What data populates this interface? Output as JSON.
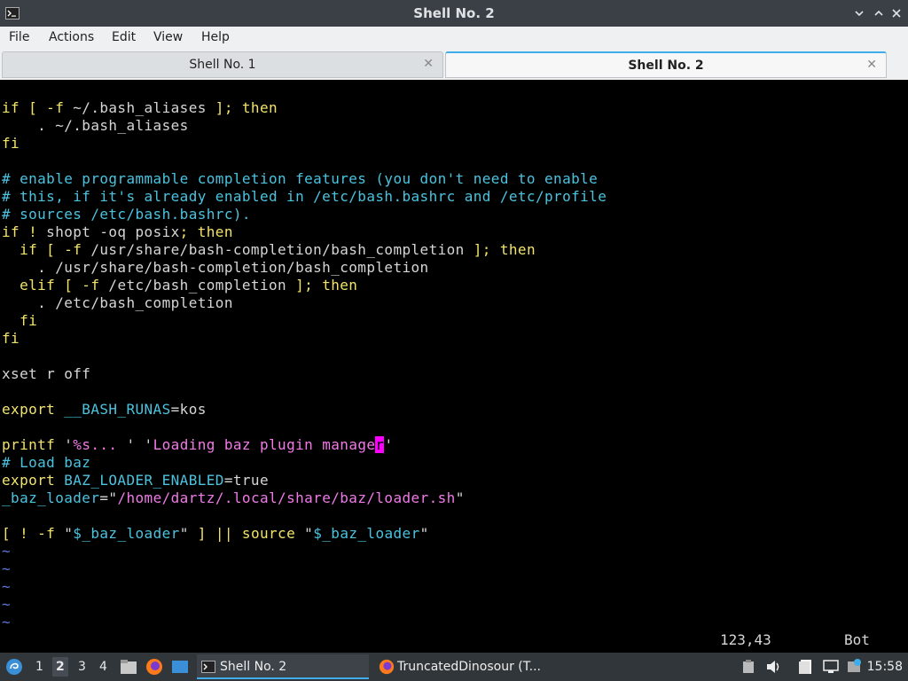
{
  "window": {
    "title": "Shell No. 2"
  },
  "menu": [
    "File",
    "Actions",
    "Edit",
    "View",
    "Help"
  ],
  "tabs": [
    {
      "label": "Shell No. 1",
      "active": false
    },
    {
      "label": "Shell No. 2",
      "active": true
    }
  ],
  "terminal": {
    "lines": [
      [],
      [
        {
          "t": "if [ -f ",
          "c": "kw"
        },
        {
          "t": "~/.bash_aliases",
          "c": "wh"
        },
        {
          "t": " ]; then",
          "c": "kw"
        }
      ],
      [
        {
          "t": "    . ~/.bash_aliases",
          "c": "wh"
        }
      ],
      [
        {
          "t": "fi",
          "c": "kw"
        }
      ],
      [],
      [
        {
          "t": "# enable programmable completion features (you don't need to enable",
          "c": "cy"
        }
      ],
      [
        {
          "t": "# this, if it's already enabled in /etc/bash.bashrc and /etc/profile",
          "c": "cy"
        }
      ],
      [
        {
          "t": "# sources /etc/bash.bashrc).",
          "c": "cy"
        }
      ],
      [
        {
          "t": "if ! ",
          "c": "kw"
        },
        {
          "t": "shopt -oq posix",
          "c": "wh"
        },
        {
          "t": "; then",
          "c": "kw"
        }
      ],
      [
        {
          "t": "  if [ -f ",
          "c": "kw"
        },
        {
          "t": "/usr/share/bash-completion/bash_completion",
          "c": "wh"
        },
        {
          "t": " ]; then",
          "c": "kw"
        }
      ],
      [
        {
          "t": "    . /usr/share/bash-completion/bash_completion",
          "c": "wh"
        }
      ],
      [
        {
          "t": "  elif [ -f ",
          "c": "kw"
        },
        {
          "t": "/etc/bash_completion",
          "c": "wh"
        },
        {
          "t": " ]; then",
          "c": "kw"
        }
      ],
      [
        {
          "t": "    . /etc/bash_completion",
          "c": "wh"
        }
      ],
      [
        {
          "t": "  fi",
          "c": "kw"
        }
      ],
      [
        {
          "t": "fi",
          "c": "kw"
        }
      ],
      [],
      [
        {
          "t": "xset r off",
          "c": "wh"
        }
      ],
      [],
      [
        {
          "t": "export ",
          "c": "kw"
        },
        {
          "t": "__BASH_RUNAS",
          "c": "cy"
        },
        {
          "t": "=kos",
          "c": "wh"
        }
      ],
      [],
      [
        {
          "t": "printf ",
          "c": "kw"
        },
        {
          "t": "'",
          "c": "wh"
        },
        {
          "t": "%s... ",
          "c": "pk"
        },
        {
          "t": "' '",
          "c": "wh"
        },
        {
          "t": "Loading baz plugin manage",
          "c": "pk"
        },
        {
          "t": "r",
          "c": "cursor"
        },
        {
          "t": "'",
          "c": "wh"
        }
      ],
      [
        {
          "t": "# Load baz",
          "c": "cy"
        }
      ],
      [
        {
          "t": "export ",
          "c": "kw"
        },
        {
          "t": "BAZ_LOADER_ENABLED",
          "c": "cy"
        },
        {
          "t": "=true",
          "c": "wh"
        }
      ],
      [
        {
          "t": "_baz_loader",
          "c": "cy"
        },
        {
          "t": "=\"",
          "c": "wh"
        },
        {
          "t": "/home/dartz/.local/share/baz/loader.sh",
          "c": "pk"
        },
        {
          "t": "\"",
          "c": "wh"
        }
      ],
      [],
      [
        {
          "t": "[ ! -f ",
          "c": "kw"
        },
        {
          "t": "\"",
          "c": "wh"
        },
        {
          "t": "$_baz_loader",
          "c": "cy"
        },
        {
          "t": "\"",
          "c": "wh"
        },
        {
          "t": " ] || source ",
          "c": "kw"
        },
        {
          "t": "\"",
          "c": "wh"
        },
        {
          "t": "$_baz_loader",
          "c": "cy"
        },
        {
          "t": "\"",
          "c": "wh"
        }
      ],
      [
        {
          "t": "~",
          "c": "tilde"
        }
      ],
      [
        {
          "t": "~",
          "c": "tilde"
        }
      ],
      [
        {
          "t": "~",
          "c": "tilde"
        }
      ],
      [
        {
          "t": "~",
          "c": "tilde"
        }
      ],
      [
        {
          "t": "~",
          "c": "tilde"
        }
      ]
    ],
    "position": "123,43",
    "scroll": "Bot"
  },
  "taskbar": {
    "desktops": [
      "1",
      "2",
      "3",
      "4"
    ],
    "active_desktop": "2",
    "tasks": [
      {
        "label": "Shell No. 2",
        "icon": "terminal-icon",
        "active": true
      },
      {
        "label": "TruncatedDinosour (T...",
        "icon": "firefox-icon",
        "active": false
      }
    ],
    "clock": "15:58"
  },
  "colors": {
    "keyword": "#f2e46b",
    "comment": "#4bc3df",
    "string": "#f07be7",
    "cursor": "#ff00ff",
    "accent": "#3daee9"
  }
}
